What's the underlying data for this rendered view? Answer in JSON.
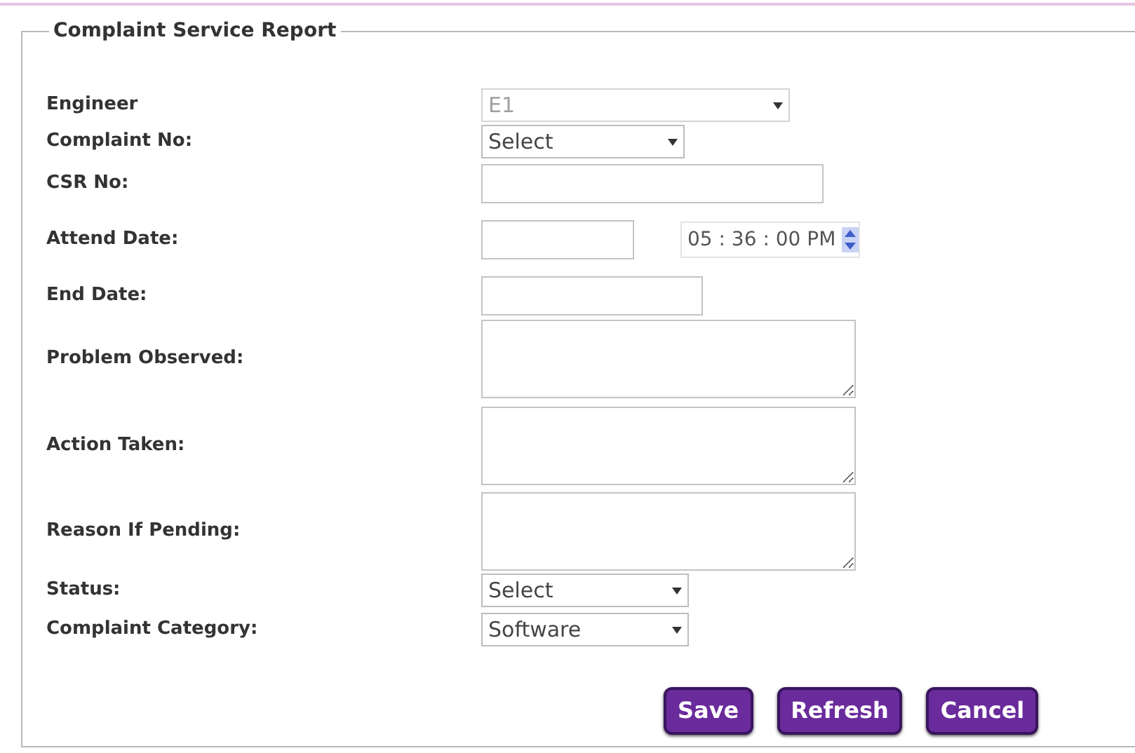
{
  "form": {
    "title": "Complaint Service Report",
    "fields": [
      {
        "kind": "select",
        "label": "Engineer",
        "value": "E1",
        "disabled": true
      },
      {
        "kind": "select",
        "label": "Complaint No:",
        "value": "Select",
        "disabled": false
      },
      {
        "kind": "text",
        "label": "CSR No:"
      },
      {
        "kind": "date_time",
        "label": "Attend Date:",
        "time": "05 : 36 : 00 PM"
      },
      {
        "kind": "text",
        "label": "End Date:"
      },
      {
        "kind": "textarea",
        "label": "Problem Observed:"
      },
      {
        "kind": "textarea",
        "label": "Action Taken:"
      },
      {
        "kind": "textarea",
        "label": "Reason If Pending:"
      },
      {
        "kind": "select",
        "label": "Status:",
        "value": "Select",
        "disabled": false
      },
      {
        "kind": "select",
        "label": "Complaint Category:",
        "value": "Software",
        "disabled": false
      }
    ],
    "buttons": [
      "Save",
      "Refresh",
      "Cancel"
    ]
  }
}
